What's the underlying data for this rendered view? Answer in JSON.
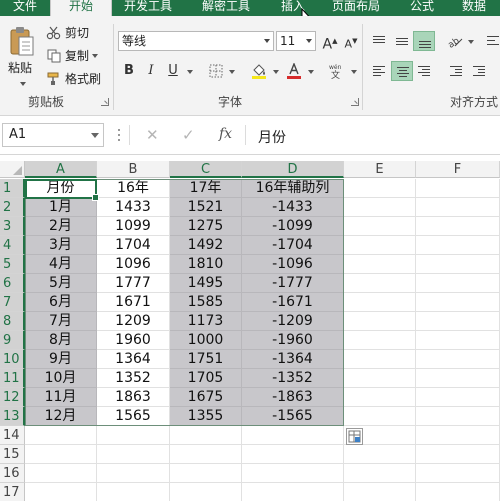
{
  "tabs": [
    {
      "label": "文件"
    },
    {
      "label": "开始"
    },
    {
      "label": "开发工具"
    },
    {
      "label": "解密工具"
    },
    {
      "label": "插入"
    },
    {
      "label": "页面布局"
    },
    {
      "label": "公式"
    },
    {
      "label": "数据"
    }
  ],
  "active_tab": "开始",
  "ribbon": {
    "clipboard": {
      "paste": "粘贴",
      "cut": "剪切",
      "copy": "复制",
      "format_painter": "格式刷",
      "group_label": "剪贴板"
    },
    "font": {
      "font_name": "等线",
      "font_size": "11",
      "grow": "A",
      "shrink": "A",
      "bold": "B",
      "italic": "I",
      "underline": "U",
      "group_label": "字体",
      "highlight_color": "#f5e71b",
      "font_color": "#d62b2b"
    },
    "alignment": {
      "group_label": "对齐方式"
    }
  },
  "formula_bar": {
    "name_box": "A1",
    "cancel": "✕",
    "enter": "✓",
    "fx": "fx",
    "content": "月份"
  },
  "columns": [
    "A",
    "B",
    "C",
    "D",
    "E",
    "F"
  ],
  "rows": [
    "1",
    "2",
    "3",
    "4",
    "5",
    "6",
    "7",
    "8",
    "9",
    "10",
    "11",
    "12",
    "13",
    "14",
    "15",
    "16",
    "17"
  ],
  "sheet": {
    "header": [
      "月份",
      "16年",
      "17年",
      "16年辅助列"
    ],
    "data": [
      [
        "1月",
        "1433",
        "1521",
        "-1433"
      ],
      [
        "2月",
        "1099",
        "1275",
        "-1099"
      ],
      [
        "3月",
        "1704",
        "1492",
        "-1704"
      ],
      [
        "4月",
        "1096",
        "1810",
        "-1096"
      ],
      [
        "5月",
        "1777",
        "1495",
        "-1777"
      ],
      [
        "6月",
        "1671",
        "1585",
        "-1671"
      ],
      [
        "7月",
        "1209",
        "1173",
        "-1209"
      ],
      [
        "8月",
        "1960",
        "1000",
        "-1960"
      ],
      [
        "9月",
        "1364",
        "1751",
        "-1364"
      ],
      [
        "10月",
        "1352",
        "1705",
        "-1352"
      ],
      [
        "11月",
        "1863",
        "1675",
        "-1863"
      ],
      [
        "12月",
        "1565",
        "1355",
        "-1565"
      ]
    ]
  },
  "colors": {
    "accent": "#217346",
    "selection_fill": "#c8c7cb"
  }
}
